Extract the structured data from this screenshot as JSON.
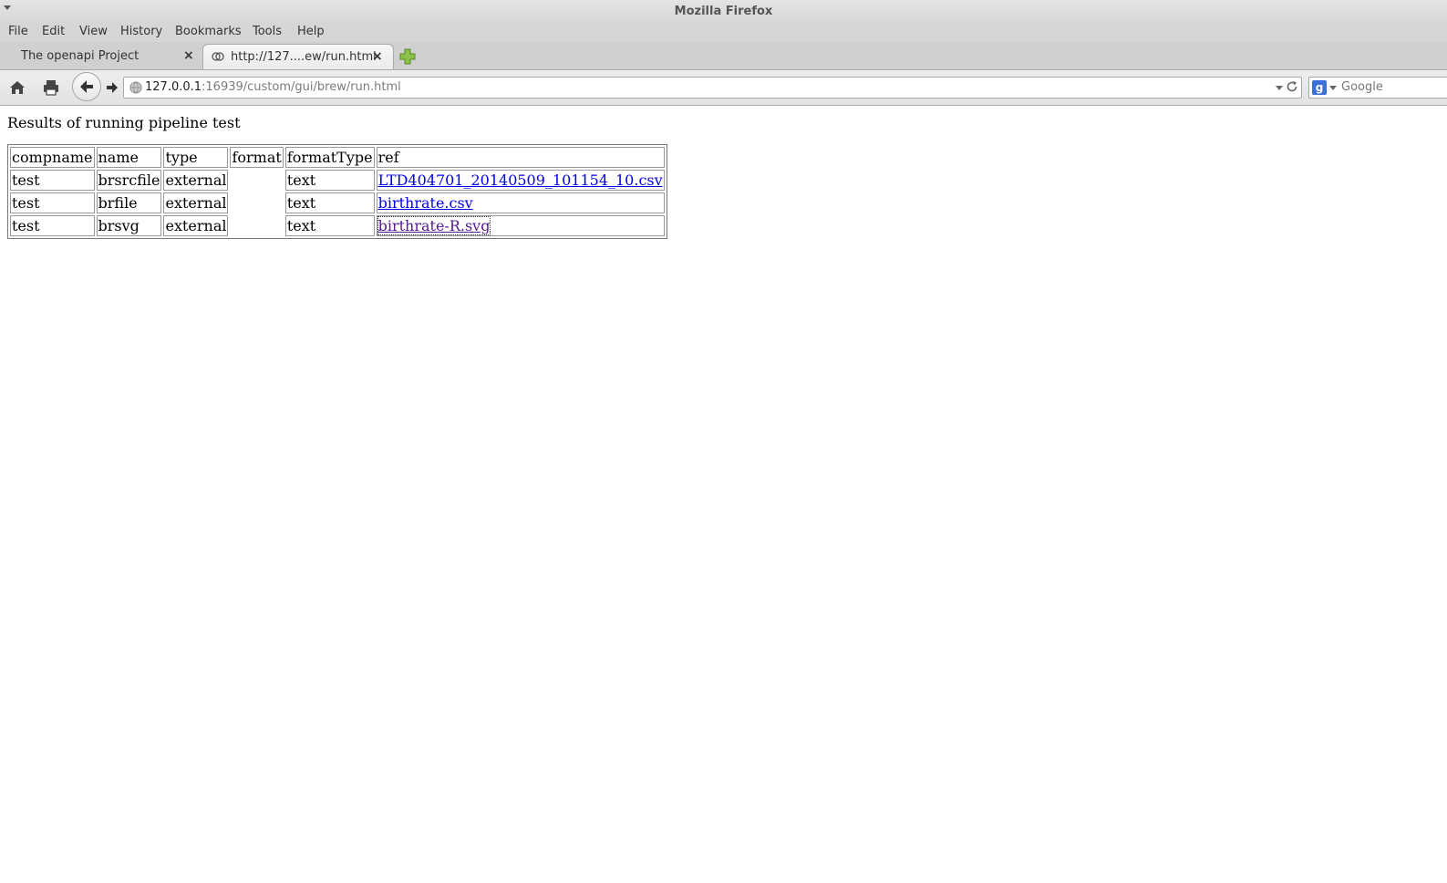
{
  "window": {
    "title": "Mozilla Firefox"
  },
  "menubar": {
    "items": [
      "File",
      "Edit",
      "View",
      "History",
      "Bookmarks",
      "Tools",
      "Help"
    ]
  },
  "tabs": [
    {
      "label": "The openapi Project",
      "active": false
    },
    {
      "label": "http://127....ew/run.html",
      "active": true
    }
  ],
  "navbar": {
    "url_host": "127.0.0.1",
    "url_rest": ":16939/custom/gui/brew/run.html",
    "search_placeholder": "Google"
  },
  "page": {
    "heading": "Results of running pipeline test",
    "table": {
      "headers": [
        "compname",
        "name",
        "type",
        "format",
        "formatType",
        "ref"
      ],
      "rows": [
        [
          "test",
          "brsrcfile",
          "external",
          "",
          "text",
          "LTD404701_20140509_101154_10.csv"
        ],
        [
          "test",
          "brfile",
          "external",
          "",
          "text",
          "birthrate.csv"
        ],
        [
          "test",
          "brsvg",
          "external",
          "",
          "text",
          "birthrate-R.svg"
        ]
      ]
    }
  },
  "colors": {
    "link": "#0000ee",
    "visited_link": "#551a8b",
    "chrome_bg": "#d6d6d6"
  },
  "icons": [
    "window-menu-icon",
    "close-icon",
    "favicon-icon",
    "new-tab-icon",
    "home-icon",
    "print-icon",
    "back-icon",
    "forward-icon",
    "globe-icon",
    "dropdown-icon",
    "reload-icon",
    "google-icon"
  ]
}
